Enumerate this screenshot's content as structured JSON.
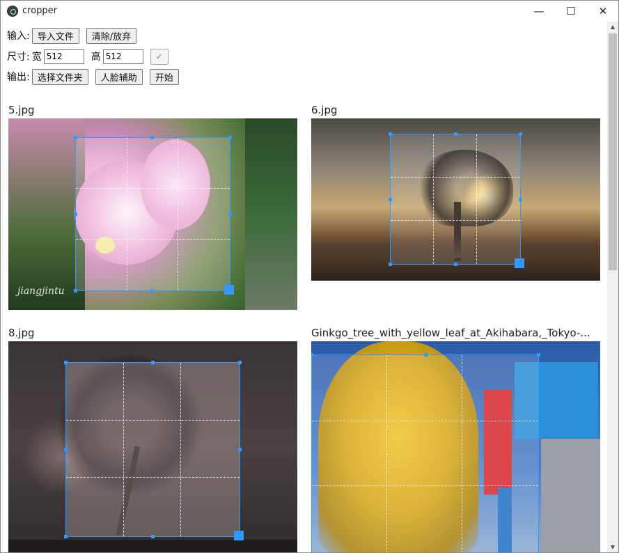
{
  "window": {
    "title": "cropper",
    "minimize": "—",
    "maximize": "☐",
    "close": "✕"
  },
  "toolbar": {
    "input_label": "输入:",
    "import_button": "导入文件",
    "clear_button": "清除/放弃",
    "size_label": "尺寸:",
    "width_label": "宽",
    "width_value": "512",
    "height_label": "高",
    "height_value": "512",
    "confirm_button": "✓",
    "output_label": "输出:",
    "select_folder_button": "选择文件夹",
    "face_assist_button": "人脸辅助",
    "start_button": "开始"
  },
  "images": [
    {
      "filename": "5.jpg",
      "watermark": "jiangjintu"
    },
    {
      "filename": "6.jpg"
    },
    {
      "filename": "8.jpg"
    },
    {
      "filename": "Ginkgo_tree_with_yellow_leaf_at_Akihabara,_Tokyo-..."
    }
  ],
  "scrollbar": {
    "up": "▲",
    "down": "▼"
  }
}
